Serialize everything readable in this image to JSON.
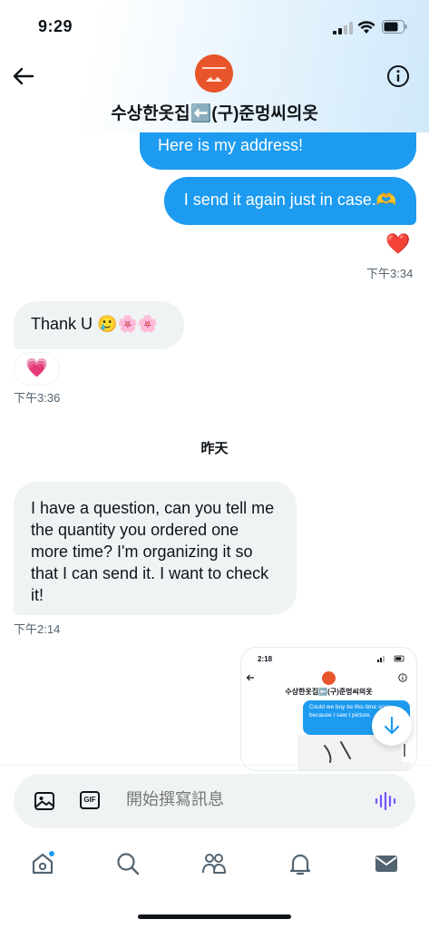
{
  "status": {
    "time": "9:29"
  },
  "header": {
    "title": "수상한옷집⬅️(구)준멍씨의옷"
  },
  "messages": {
    "out1": "Here is my address!",
    "out2": "I send it again just in case.🫶",
    "out2_reaction": "❤️",
    "out2_time": "下午3:34",
    "in1": "Thank U 🥲🌸🌸",
    "in1_reaction": "💗",
    "in1_time": "下午3:36",
    "day_separator": "昨天",
    "in2": "I have a question, can you tell me the quantity you ordered one more time? I'm organizing it so that I can send it. I want to check it!",
    "in2_time": "下午2:14"
  },
  "preview": {
    "time": "2:18",
    "title": "수상한옷집⬅️(구)준멍씨의옷",
    "bubble_text": "Could we buy tie this time sorry because I saw t picture."
  },
  "composer": {
    "placeholder": "開始撰寫訊息",
    "gif_label": "GIF"
  },
  "colors": {
    "accent": "#1d9bf0",
    "incoming_bg": "#eff3f4",
    "voice_icon": "#7856ff",
    "notification_dot": "#1d9bf0"
  },
  "icons": [
    "back-arrow-icon",
    "info-icon",
    "image-icon",
    "gif-icon",
    "voice-icon",
    "home-icon",
    "search-icon",
    "communities-icon",
    "notifications-icon",
    "messages-icon",
    "arrow-down-icon"
  ]
}
